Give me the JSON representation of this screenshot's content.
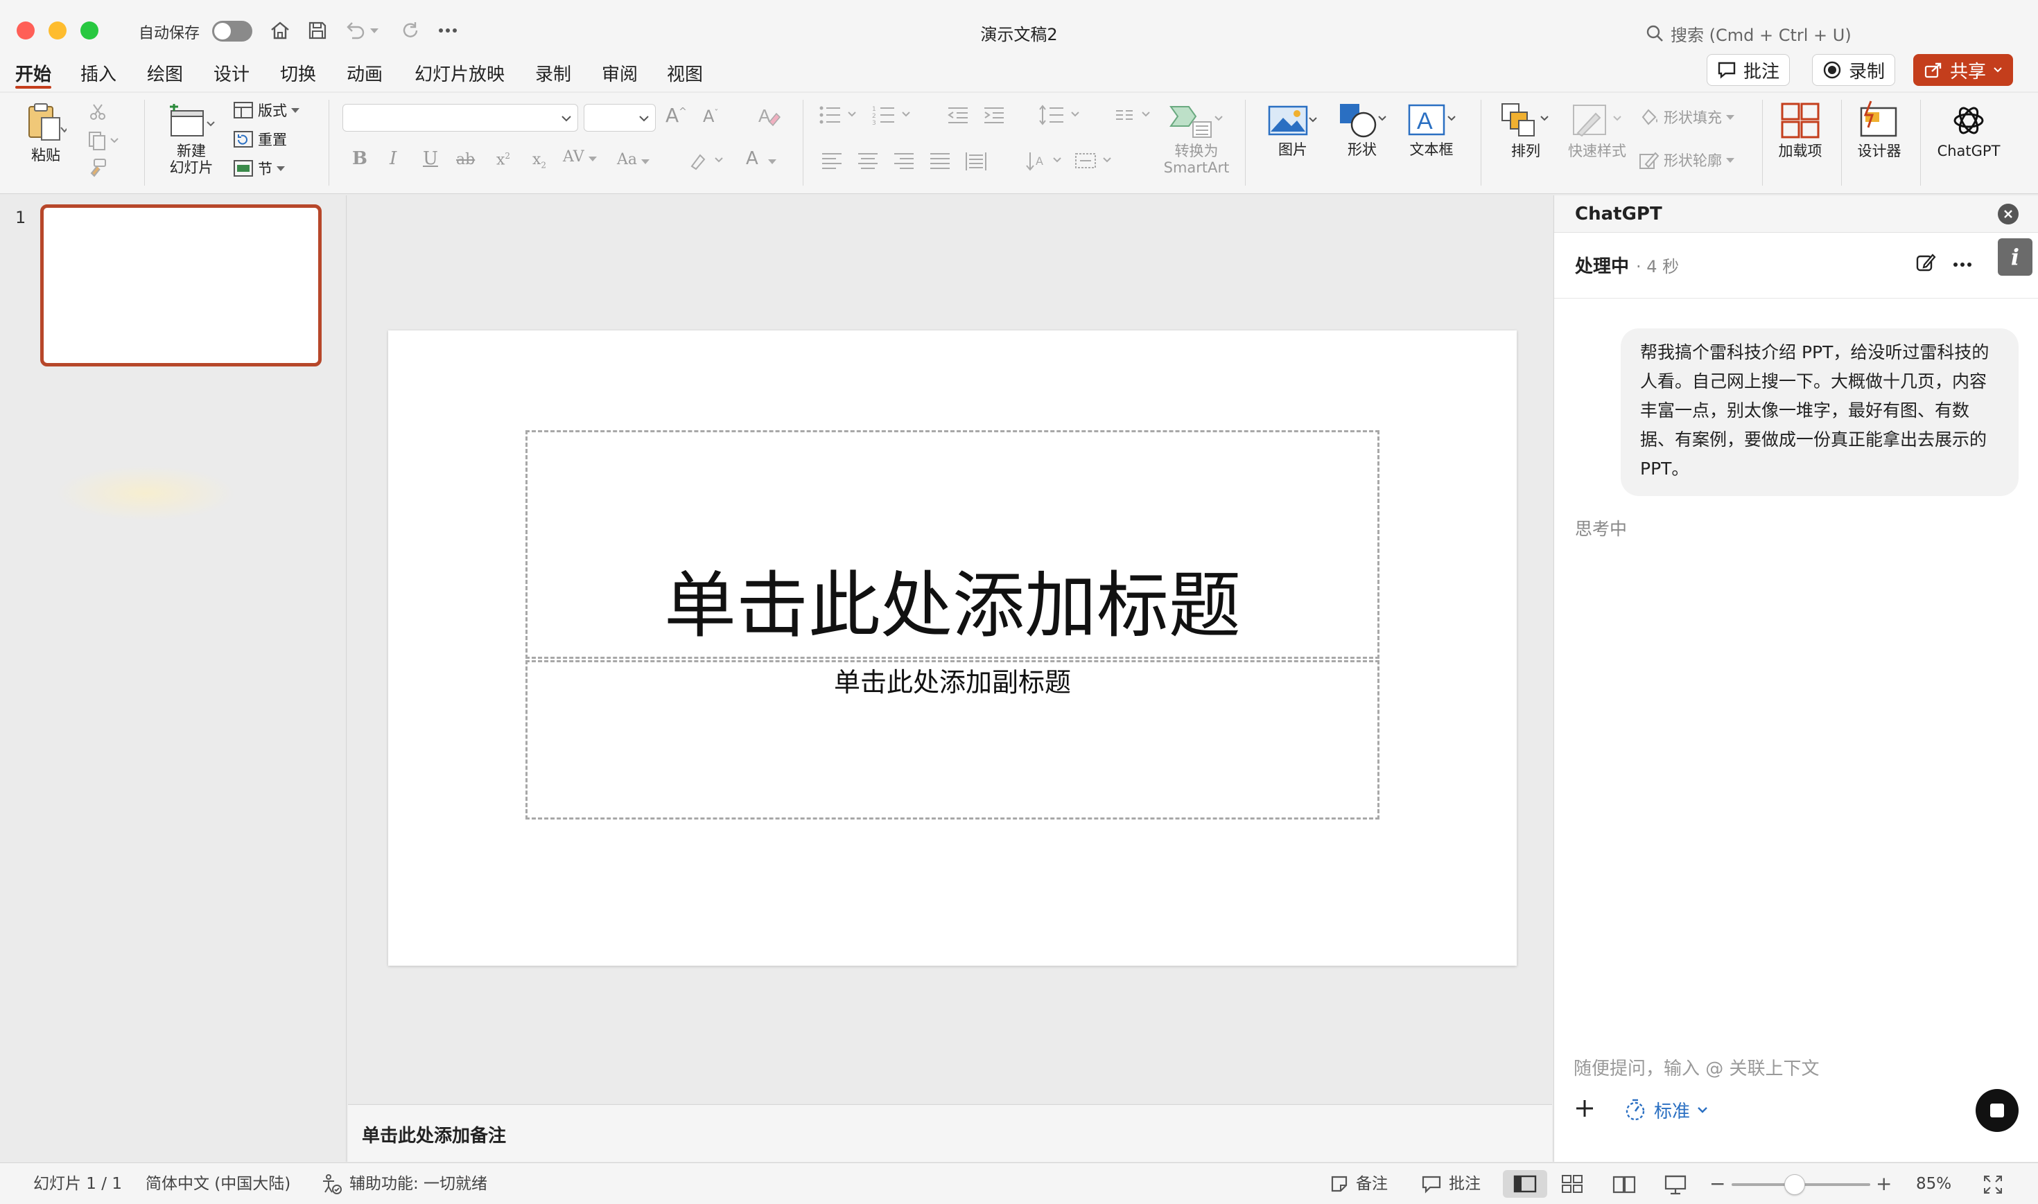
{
  "window": {
    "title": "演示文稿2"
  },
  "titlebar": {
    "autosave_label": "自动保存",
    "search_placeholder": "搜索 (Cmd + Ctrl + U)"
  },
  "tabs": [
    "开始",
    "插入",
    "绘图",
    "设计",
    "切换",
    "动画",
    "幻灯片放映",
    "录制",
    "审阅",
    "视图"
  ],
  "header_buttons": {
    "comments": "批注",
    "record": "录制",
    "share": "共享"
  },
  "ribbon": {
    "paste": "粘贴",
    "new_slide_line1": "新建",
    "new_slide_line2": "幻灯片",
    "layout": "版式",
    "reset": "重置",
    "section": "节",
    "font_name": "",
    "font_size": "",
    "to_smartart_line1": "转换为",
    "to_smartart_line2": "SmartArt",
    "picture": "图片",
    "shape": "形状",
    "textbox": "文本框",
    "arrange": "排列",
    "quick_styles": "快速样式",
    "shape_fill": "形状填充",
    "shape_outline": "形状轮廓",
    "addins": "加载项",
    "designer": "设计器",
    "chatgpt": "ChatGPT"
  },
  "thumbnails": {
    "slide_number": "1"
  },
  "slide": {
    "title_placeholder": "单击此处添加标题",
    "subtitle_placeholder": "单击此处添加副标题"
  },
  "notes": {
    "placeholder": "单击此处添加备注"
  },
  "chat": {
    "panel_title": "ChatGPT",
    "status": "处理中",
    "elapsed": "· 4 秒",
    "user_message": "帮我搞个雷科技介绍 PPT，给没听过雷科技的人看。自己网上搜一下。大概做十几页，内容丰富一点，别太像一堆字，最好有图、有数据、有案例，要做成一份真正能拿出去展示的 PPT。",
    "thinking": "思考中",
    "input_placeholder": "随便提问，输入 @ 关联上下文",
    "mode": "标准"
  },
  "statusbar": {
    "slide_count": "幻灯片 1 / 1",
    "language": "简体中文 (中国大陆)",
    "accessibility": "辅助功能: 一切就绪",
    "notes": "备注",
    "comments": "批注",
    "zoom": "85%"
  },
  "colors": {
    "accent": "#c43e1c",
    "share": "#c43e1c",
    "thumb_border": "#b7472a",
    "close": "#ff5f57",
    "minimize": "#febc2e",
    "maximize": "#28c840"
  }
}
